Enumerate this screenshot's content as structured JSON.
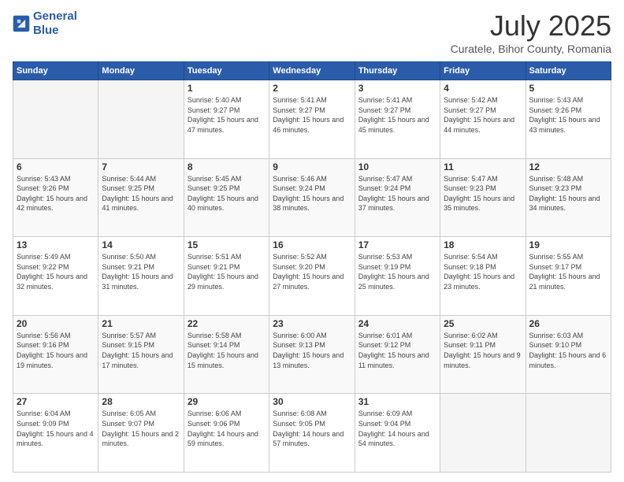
{
  "header": {
    "logo_line1": "General",
    "logo_line2": "Blue",
    "main_title": "July 2025",
    "sub_title": "Curatele, Bihor County, Romania"
  },
  "days_of_week": [
    "Sunday",
    "Monday",
    "Tuesday",
    "Wednesday",
    "Thursday",
    "Friday",
    "Saturday"
  ],
  "weeks": [
    [
      {
        "day": "",
        "info": ""
      },
      {
        "day": "",
        "info": ""
      },
      {
        "day": "1",
        "info": "Sunrise: 5:40 AM\nSunset: 9:27 PM\nDaylight: 15 hours\nand 47 minutes."
      },
      {
        "day": "2",
        "info": "Sunrise: 5:41 AM\nSunset: 9:27 PM\nDaylight: 15 hours\nand 46 minutes."
      },
      {
        "day": "3",
        "info": "Sunrise: 5:41 AM\nSunset: 9:27 PM\nDaylight: 15 hours\nand 45 minutes."
      },
      {
        "day": "4",
        "info": "Sunrise: 5:42 AM\nSunset: 9:27 PM\nDaylight: 15 hours\nand 44 minutes."
      },
      {
        "day": "5",
        "info": "Sunrise: 5:43 AM\nSunset: 9:26 PM\nDaylight: 15 hours\nand 43 minutes."
      }
    ],
    [
      {
        "day": "6",
        "info": "Sunrise: 5:43 AM\nSunset: 9:26 PM\nDaylight: 15 hours\nand 42 minutes."
      },
      {
        "day": "7",
        "info": "Sunrise: 5:44 AM\nSunset: 9:25 PM\nDaylight: 15 hours\nand 41 minutes."
      },
      {
        "day": "8",
        "info": "Sunrise: 5:45 AM\nSunset: 9:25 PM\nDaylight: 15 hours\nand 40 minutes."
      },
      {
        "day": "9",
        "info": "Sunrise: 5:46 AM\nSunset: 9:24 PM\nDaylight: 15 hours\nand 38 minutes."
      },
      {
        "day": "10",
        "info": "Sunrise: 5:47 AM\nSunset: 9:24 PM\nDaylight: 15 hours\nand 37 minutes."
      },
      {
        "day": "11",
        "info": "Sunrise: 5:47 AM\nSunset: 9:23 PM\nDaylight: 15 hours\nand 35 minutes."
      },
      {
        "day": "12",
        "info": "Sunrise: 5:48 AM\nSunset: 9:23 PM\nDaylight: 15 hours\nand 34 minutes."
      }
    ],
    [
      {
        "day": "13",
        "info": "Sunrise: 5:49 AM\nSunset: 9:22 PM\nDaylight: 15 hours\nand 32 minutes."
      },
      {
        "day": "14",
        "info": "Sunrise: 5:50 AM\nSunset: 9:21 PM\nDaylight: 15 hours\nand 31 minutes."
      },
      {
        "day": "15",
        "info": "Sunrise: 5:51 AM\nSunset: 9:21 PM\nDaylight: 15 hours\nand 29 minutes."
      },
      {
        "day": "16",
        "info": "Sunrise: 5:52 AM\nSunset: 9:20 PM\nDaylight: 15 hours\nand 27 minutes."
      },
      {
        "day": "17",
        "info": "Sunrise: 5:53 AM\nSunset: 9:19 PM\nDaylight: 15 hours\nand 25 minutes."
      },
      {
        "day": "18",
        "info": "Sunrise: 5:54 AM\nSunset: 9:18 PM\nDaylight: 15 hours\nand 23 minutes."
      },
      {
        "day": "19",
        "info": "Sunrise: 5:55 AM\nSunset: 9:17 PM\nDaylight: 15 hours\nand 21 minutes."
      }
    ],
    [
      {
        "day": "20",
        "info": "Sunrise: 5:56 AM\nSunset: 9:16 PM\nDaylight: 15 hours\nand 19 minutes."
      },
      {
        "day": "21",
        "info": "Sunrise: 5:57 AM\nSunset: 9:15 PM\nDaylight: 15 hours\nand 17 minutes."
      },
      {
        "day": "22",
        "info": "Sunrise: 5:58 AM\nSunset: 9:14 PM\nDaylight: 15 hours\nand 15 minutes."
      },
      {
        "day": "23",
        "info": "Sunrise: 6:00 AM\nSunset: 9:13 PM\nDaylight: 15 hours\nand 13 minutes."
      },
      {
        "day": "24",
        "info": "Sunrise: 6:01 AM\nSunset: 9:12 PM\nDaylight: 15 hours\nand 11 minutes."
      },
      {
        "day": "25",
        "info": "Sunrise: 6:02 AM\nSunset: 9:11 PM\nDaylight: 15 hours\nand 9 minutes."
      },
      {
        "day": "26",
        "info": "Sunrise: 6:03 AM\nSunset: 9:10 PM\nDaylight: 15 hours\nand 6 minutes."
      }
    ],
    [
      {
        "day": "27",
        "info": "Sunrise: 6:04 AM\nSunset: 9:09 PM\nDaylight: 15 hours\nand 4 minutes."
      },
      {
        "day": "28",
        "info": "Sunrise: 6:05 AM\nSunset: 9:07 PM\nDaylight: 15 hours\nand 2 minutes."
      },
      {
        "day": "29",
        "info": "Sunrise: 6:06 AM\nSunset: 9:06 PM\nDaylight: 14 hours\nand 59 minutes."
      },
      {
        "day": "30",
        "info": "Sunrise: 6:08 AM\nSunset: 9:05 PM\nDaylight: 14 hours\nand 57 minutes."
      },
      {
        "day": "31",
        "info": "Sunrise: 6:09 AM\nSunset: 9:04 PM\nDaylight: 14 hours\nand 54 minutes."
      },
      {
        "day": "",
        "info": ""
      },
      {
        "day": "",
        "info": ""
      }
    ]
  ]
}
